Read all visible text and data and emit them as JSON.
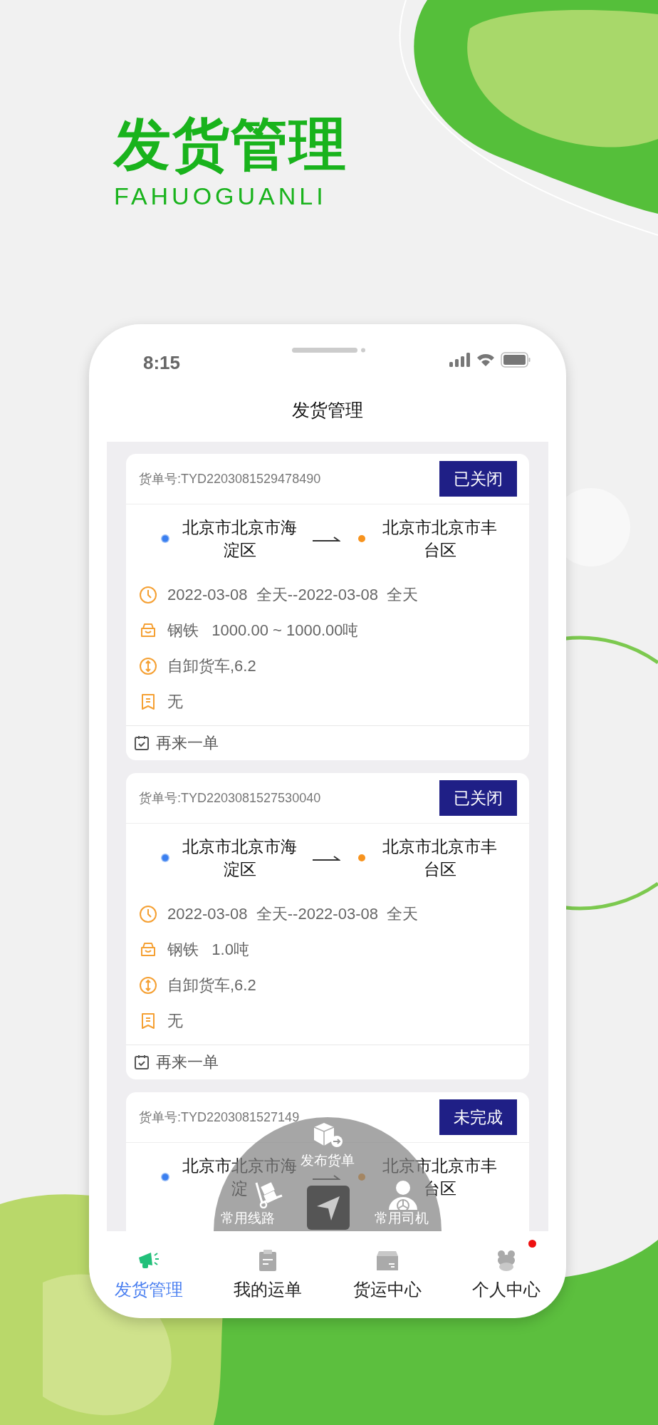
{
  "headline": {
    "title": "发货管理",
    "subtitle": "FAHUOGUANLI"
  },
  "status_bar": {
    "time": "8:15"
  },
  "screen": {
    "title": "发货管理"
  },
  "orders": [
    {
      "order_no": "货单号:TYD2203081529478490",
      "status": "已关闭",
      "from": [
        "北京市北京市海",
        "淀区"
      ],
      "to": [
        "北京市北京市丰",
        "台区"
      ],
      "details": [
        {
          "kind": "time",
          "text": "2022-03-08  全天--2022-03-08  全天"
        },
        {
          "kind": "goods",
          "text": "钢铁   1000.00 ~ 1000.00吨"
        },
        {
          "kind": "vehicle",
          "text": "自卸货车,6.2"
        },
        {
          "kind": "note",
          "text": "无"
        }
      ],
      "action": "再来一单"
    },
    {
      "order_no": "货单号:TYD2203081527530040",
      "status": "已关闭",
      "from": [
        "北京市北京市海",
        "淀区"
      ],
      "to": [
        "北京市北京市丰",
        "台区"
      ],
      "details": [
        {
          "kind": "time",
          "text": "2022-03-08  全天--2022-03-08  全天"
        },
        {
          "kind": "goods",
          "text": "钢铁   1.0吨"
        },
        {
          "kind": "vehicle",
          "text": "自卸货车,6.2"
        },
        {
          "kind": "note",
          "text": "无"
        }
      ],
      "action": "再来一单"
    },
    {
      "order_no": "货单号:TYD2203081527149",
      "status": "未完成",
      "from": [
        "北京市北京市海",
        "淀"
      ],
      "to": [
        "北京市北京市丰",
        "台区"
      ]
    }
  ],
  "quick_menu": {
    "items": [
      {
        "kind": "publish",
        "label": "发布货单"
      },
      {
        "kind": "route",
        "label": "常用线路"
      },
      {
        "kind": "driver",
        "label": "常用司机"
      }
    ]
  },
  "tab_bar": [
    {
      "kind": "megaphone",
      "label": "发货管理",
      "selected": true,
      "dot": false
    },
    {
      "kind": "clipboard",
      "label": "我的运单",
      "selected": false,
      "dot": false
    },
    {
      "kind": "box",
      "label": "货运中心",
      "selected": false,
      "dot": false
    },
    {
      "kind": "frog",
      "label": "个人中心",
      "selected": false,
      "dot": true
    }
  ]
}
